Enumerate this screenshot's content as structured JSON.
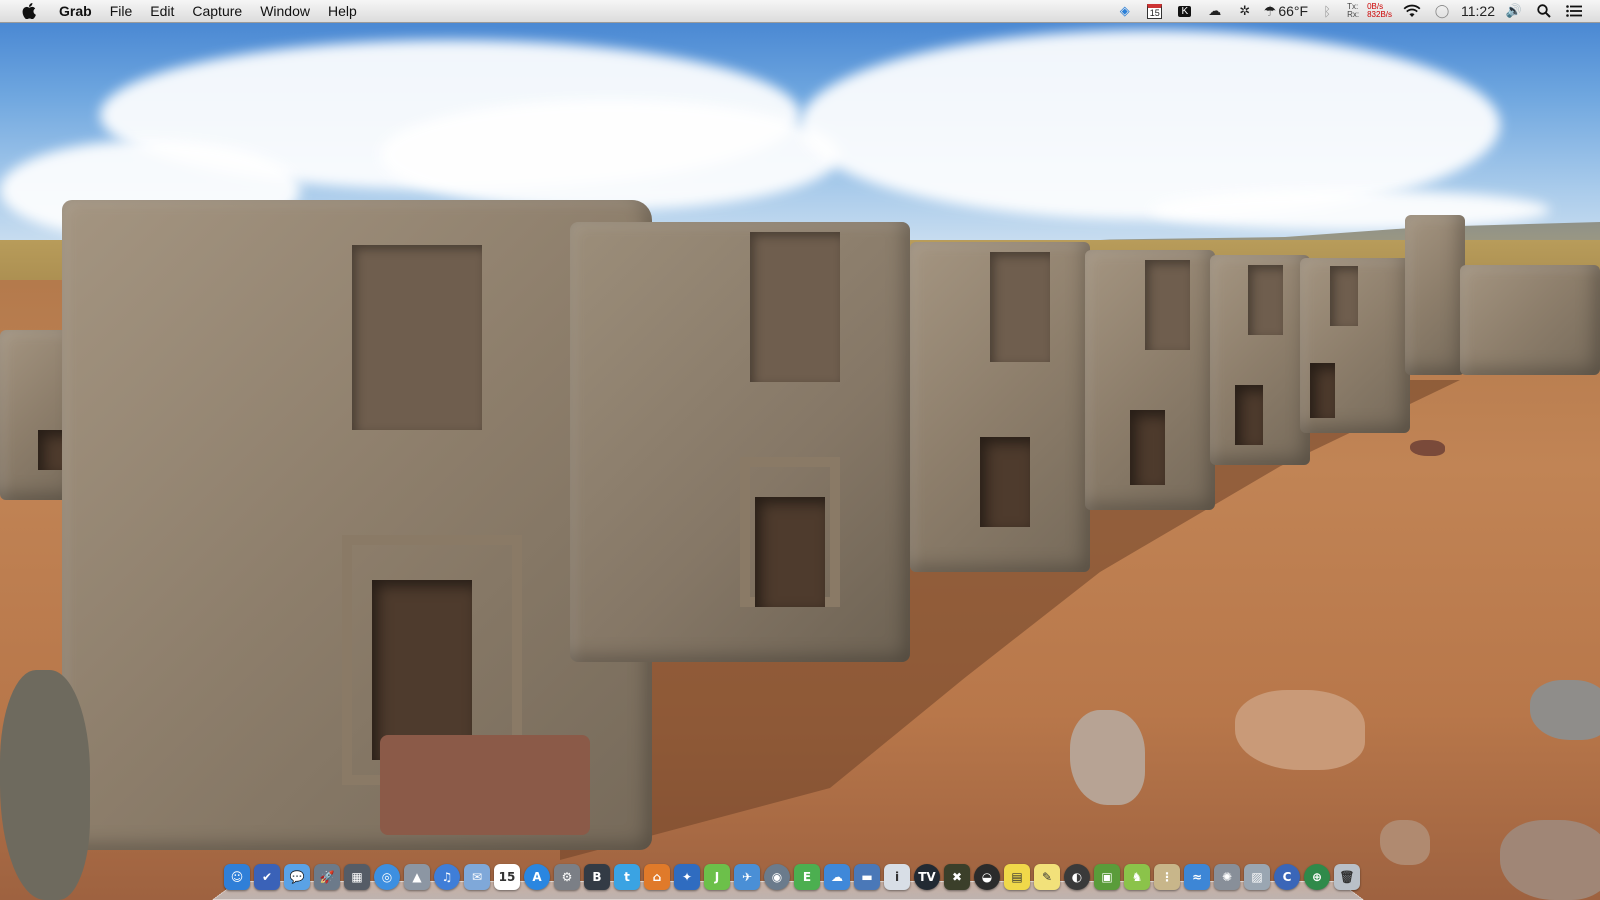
{
  "menubar": {
    "app_name": "Grab",
    "menus": [
      "File",
      "Edit",
      "Capture",
      "Window",
      "Help"
    ],
    "status": {
      "calendar_day": "15",
      "weather_temp": "66°F",
      "network_tx_label": "Tx:",
      "network_tx_value": "0B/s",
      "network_rx_label": "Rx:",
      "network_rx_value": "832B/s",
      "clock": "11:22"
    }
  },
  "dock": {
    "calendar_day": "15",
    "icons": [
      {
        "name": "finder-icon",
        "glyph": "☺",
        "bg": "#2f7fd8"
      },
      {
        "name": "omnifocus-icon",
        "glyph": "✔",
        "bg": "#3a62b8"
      },
      {
        "name": "messages-icon",
        "glyph": "💬",
        "bg": "#5aa2e6"
      },
      {
        "name": "launchpad-icon",
        "glyph": "🚀",
        "bg": "#6c7a8a"
      },
      {
        "name": "preferences-icon",
        "glyph": "▦",
        "bg": "#555c66"
      },
      {
        "name": "safari-icon",
        "glyph": "◎",
        "bg": "#3d8fe0"
      },
      {
        "name": "preview-icon",
        "glyph": "▲",
        "bg": "#8c96a3"
      },
      {
        "name": "itunes-icon",
        "glyph": "♫",
        "bg": "#3f7ed8"
      },
      {
        "name": "mail-icon",
        "glyph": "✉",
        "bg": "#7fa8d9"
      },
      {
        "name": "calendar-icon",
        "glyph": "15",
        "bg": "#ffffff"
      },
      {
        "name": "app-store-icon",
        "glyph": "A",
        "bg": "#2a86e0"
      },
      {
        "name": "system-prefs-icon",
        "glyph": "⚙",
        "bg": "#7b7f86"
      },
      {
        "name": "bbedit-icon",
        "glyph": "B",
        "bg": "#333b45"
      },
      {
        "name": "twitter-icon",
        "glyph": "t",
        "bg": "#3aa3e3"
      },
      {
        "name": "home-icon",
        "glyph": "⌂",
        "bg": "#e07a2a"
      },
      {
        "name": "xcode-icon",
        "glyph": "✦",
        "bg": "#2f6cc0"
      },
      {
        "name": "jaksta-icon",
        "glyph": "J",
        "bg": "#6cc04a"
      },
      {
        "name": "tweetbot-icon",
        "glyph": "✈",
        "bg": "#4a8fd6"
      },
      {
        "name": "network-icon",
        "glyph": "◉",
        "bg": "#6b7b8c"
      },
      {
        "name": "evernote-icon",
        "glyph": "E",
        "bg": "#4caf50"
      },
      {
        "name": "cloud-app-icon",
        "glyph": "☁",
        "bg": "#3f88d9"
      },
      {
        "name": "disk-icon",
        "glyph": "▬",
        "bg": "#4a78b8"
      },
      {
        "name": "textedit-icon",
        "glyph": "i",
        "bg": "#d8dee6"
      },
      {
        "name": "tv-icon",
        "glyph": "TV",
        "bg": "#222a33"
      },
      {
        "name": "camera-icon",
        "glyph": "✖",
        "bg": "#3b3f2a"
      },
      {
        "name": "alfred-icon",
        "glyph": "◒",
        "bg": "#2b2b2b"
      },
      {
        "name": "stickies-icon",
        "glyph": "▤",
        "bg": "#f0d84a"
      },
      {
        "name": "notes-icon",
        "glyph": "✎",
        "bg": "#f2e17a"
      },
      {
        "name": "color-icon",
        "glyph": "◐",
        "bg": "#3a3a3a"
      },
      {
        "name": "photo-icon",
        "glyph": "▣",
        "bg": "#5a9c3a"
      },
      {
        "name": "android-icon",
        "glyph": "♞",
        "bg": "#8bc34a"
      },
      {
        "name": "abacus-icon",
        "glyph": "⋮",
        "bg": "#c8b68a"
      },
      {
        "name": "airport-icon",
        "glyph": "≈",
        "bg": "#3d86d6"
      },
      {
        "name": "burst-icon",
        "glyph": "✺",
        "bg": "#888f99"
      },
      {
        "name": "pics-icon",
        "glyph": "▨",
        "bg": "#9aa6b2"
      },
      {
        "name": "c-app-icon",
        "glyph": "C",
        "bg": "#3a66b8"
      },
      {
        "name": "globe-icon",
        "glyph": "⊕",
        "bg": "#2f8a4a"
      },
      {
        "name": "trash-icon",
        "glyph": "🗑",
        "bg": "#b9c0c8"
      }
    ]
  },
  "colors": {
    "menubar_bg": "#e9e9e9",
    "rx_red": "#cc0000"
  }
}
